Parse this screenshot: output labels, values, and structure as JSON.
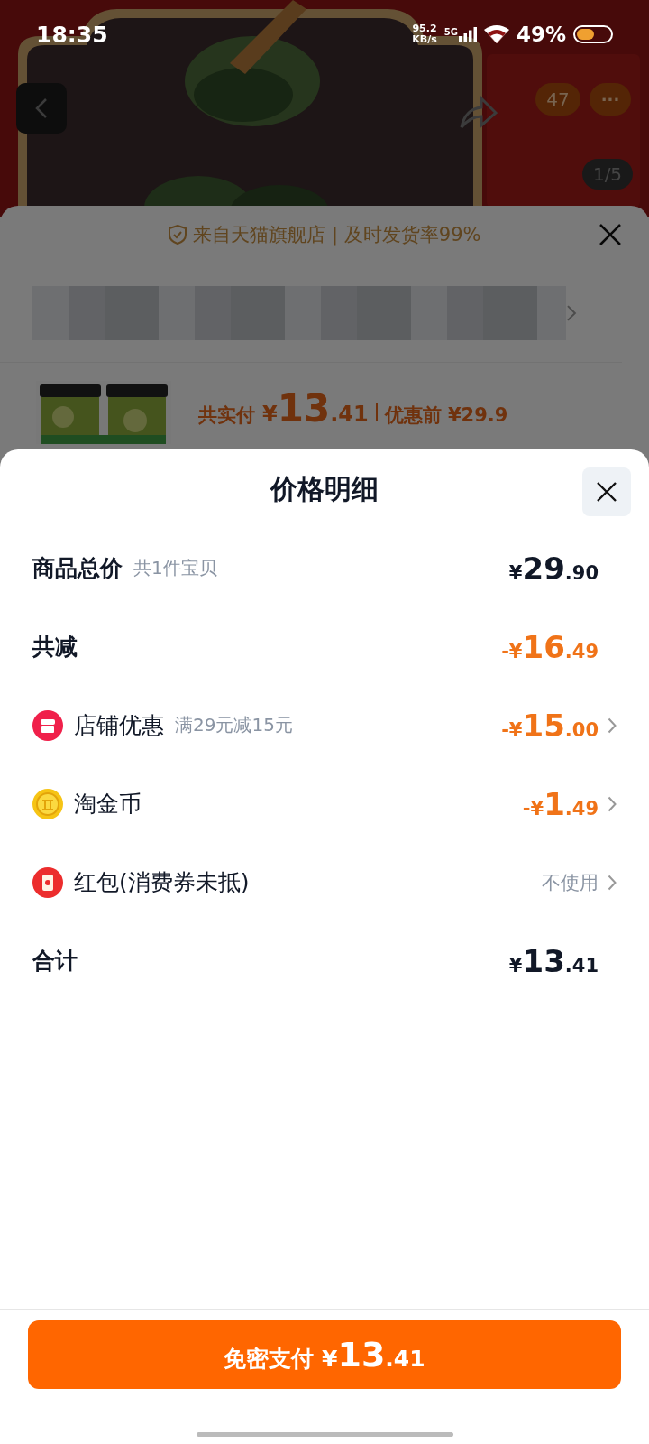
{
  "status_bar": {
    "time": "18:35",
    "speed": "95.2",
    "speed_unit": "KB/s",
    "network": "5G",
    "battery": "49%"
  },
  "product_header": {
    "cart_count": "47",
    "more": "···",
    "image_counter": "1/5"
  },
  "back_sheet": {
    "store_banner": "来自天猫旗舰店 | 及时发货率99%",
    "price_label": "共实付",
    "price": {
      "prefix": "¥",
      "integer": "13",
      "decimal": ".41"
    },
    "before_label": "优惠前",
    "before_price": "¥29.9"
  },
  "price_sheet": {
    "title": "价格明细",
    "rows": [
      {
        "kind": "summary",
        "label": "商品总价",
        "note": "共1件宝贝",
        "amount": {
          "prefix": "¥",
          "integer": "29",
          "decimal": ".90"
        },
        "discount": false,
        "link": false
      },
      {
        "kind": "summary",
        "label": "共减",
        "amount": {
          "prefix": "-¥",
          "integer": "16",
          "decimal": ".49"
        },
        "discount": true,
        "link": false
      },
      {
        "kind": "store",
        "label": "店铺优惠",
        "note": "满29元减15元",
        "amount": {
          "prefix": "-¥",
          "integer": "15",
          "decimal": ".00"
        },
        "discount": true,
        "link": true
      },
      {
        "kind": "coins",
        "label": "淘金币",
        "amount": {
          "prefix": "-¥",
          "integer": "1",
          "decimal": ".49"
        },
        "discount": true,
        "link": true
      },
      {
        "kind": "redpacket",
        "label": "红包(消费券未抵)",
        "value": "不使用",
        "discount": false,
        "link": true
      },
      {
        "kind": "summary",
        "label": "合计",
        "amount": {
          "prefix": "¥",
          "integer": "13",
          "decimal": ".41"
        },
        "discount": false,
        "link": false
      }
    ],
    "pay_button": {
      "label": "免密支付",
      "amount": {
        "prefix": "¥",
        "integer": "13",
        "decimal": ".41"
      }
    }
  }
}
